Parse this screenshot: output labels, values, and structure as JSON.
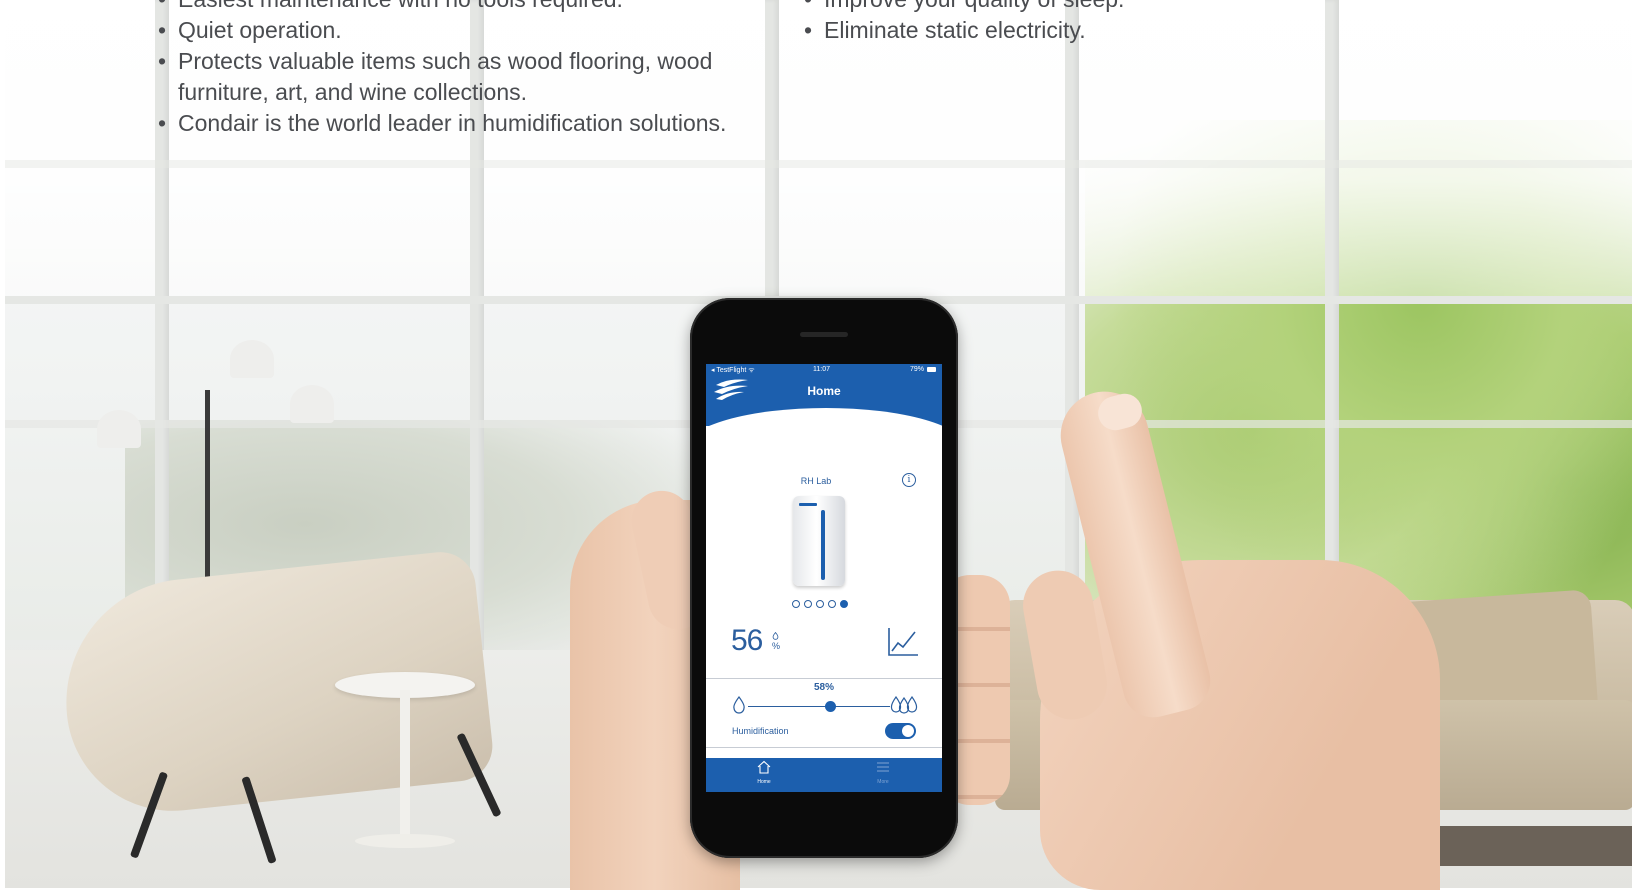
{
  "bullets_left": [
    "Easiest maintenance with no tools required.",
    "Quiet operation.",
    "Protects valuable items such as wood flooring, wood furniture, art, and wine collections.",
    "Condair is the world leader in humidification solutions."
  ],
  "bullets_right": [
    "Improve your quality of sleep.",
    "Eliminate static electricity."
  ],
  "app": {
    "status_bar": {
      "carrier": "◂ TestFlight ᯤ",
      "time": "11:07",
      "battery": "79%"
    },
    "title": "Home",
    "device_name": "RH Lab",
    "info_icon": "i",
    "carousel": {
      "pages": 5,
      "active_page": 5
    },
    "humidity_reading": "56",
    "humidity_unit": "%",
    "setpoint": "58%",
    "setpoint_fraction": 0.58,
    "humidification_label": "Humidification",
    "humidification_on": true,
    "tabs": [
      {
        "label": "Home",
        "icon": "home-icon",
        "active": true
      },
      {
        "label": "More",
        "icon": "menu-icon",
        "active": false
      }
    ]
  },
  "colors": {
    "brand_blue": "#1c5fae",
    "text_gray": "#4a4c50",
    "foliage_green": "#9cc561"
  }
}
